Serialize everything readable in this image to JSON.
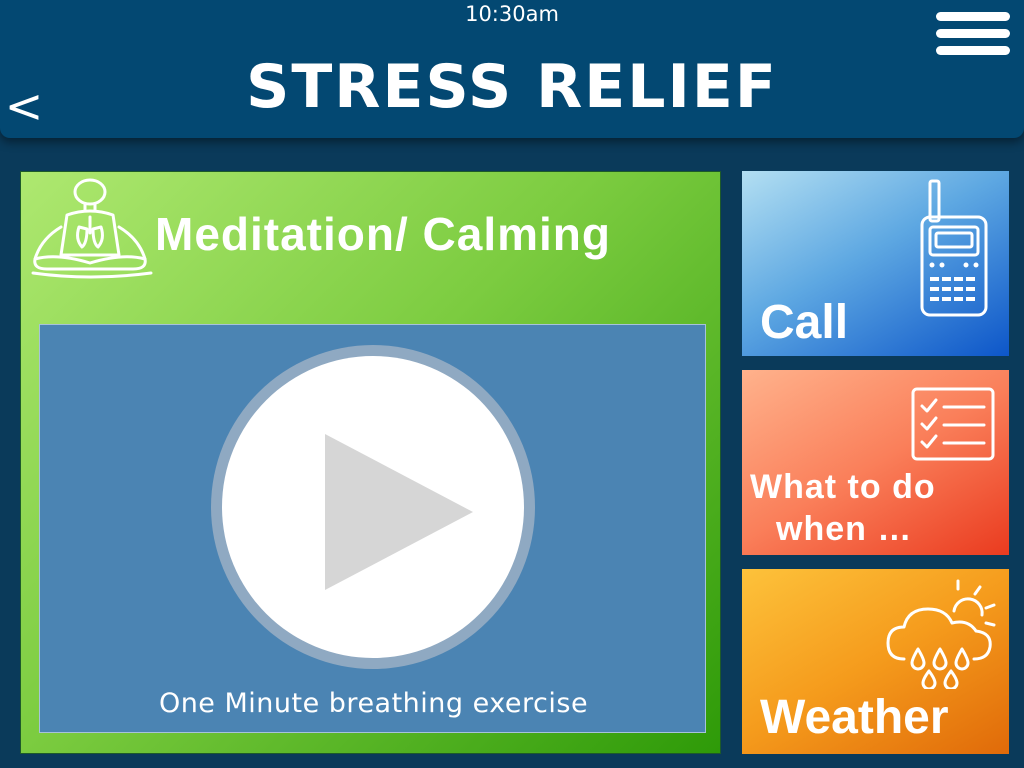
{
  "header": {
    "time": "10:30am",
    "title": "STRESS RELIEF",
    "back_label": "<",
    "menu_icon": "hamburger-menu-icon"
  },
  "main": {
    "title": "Meditation/ Calming",
    "icon": "meditation-person-icon",
    "video": {
      "caption": "One Minute breathing exercise",
      "play_icon": "play-icon"
    }
  },
  "tiles": [
    {
      "id": "call",
      "label": "Call",
      "icon": "walkie-talkie-icon",
      "color": "#0d56c9"
    },
    {
      "id": "what-to-do",
      "label_line1": "What to do",
      "label_line2": "when …",
      "icon": "checklist-icon",
      "color": "#ea3b1f"
    },
    {
      "id": "weather",
      "label": "Weather",
      "icon": "weather-rain-sun-icon",
      "color": "#e06a09"
    }
  ],
  "colors": {
    "header_bg": "#034872",
    "page_bg": "#0a3a5a",
    "meditation_green": "#7ccc40",
    "video_bg": "#4b84b3"
  }
}
